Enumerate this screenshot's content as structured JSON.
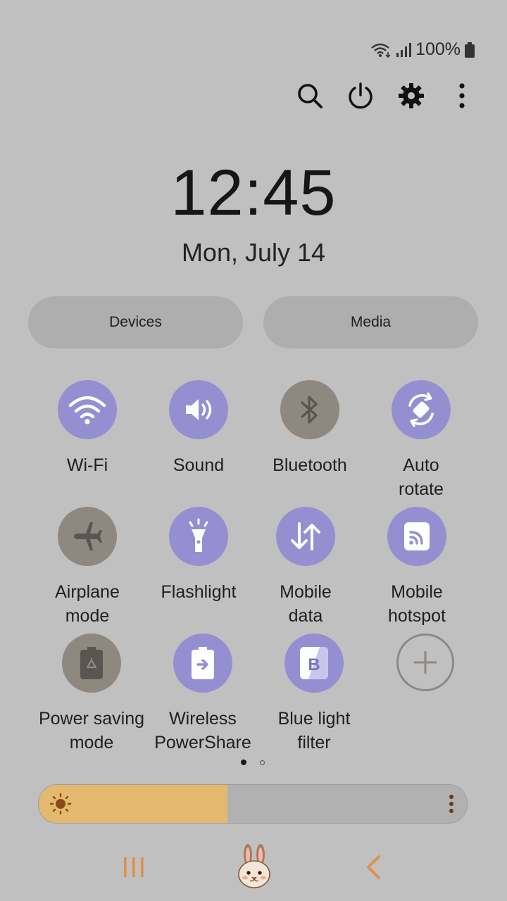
{
  "status_bar": {
    "battery_text": "100%",
    "icons": [
      "wifi-signal-icon",
      "cellular-signal-icon",
      "battery-icon"
    ]
  },
  "top_actions": [
    {
      "name": "search-icon"
    },
    {
      "name": "power-icon"
    },
    {
      "name": "settings-gear-icon"
    },
    {
      "name": "more-options-icon"
    }
  ],
  "clock": {
    "time": "12:45",
    "date": "Mon, July 14"
  },
  "pills": {
    "devices": "Devices",
    "media": "Media"
  },
  "tiles": [
    {
      "label": "Wi-Fi",
      "state": "on",
      "icon": "wifi-icon"
    },
    {
      "label": "Sound",
      "state": "on",
      "icon": "speaker-icon"
    },
    {
      "label": "Bluetooth",
      "state": "off",
      "icon": "bluetooth-icon"
    },
    {
      "label": "Auto\nrotate",
      "state": "on",
      "icon": "auto-rotate-icon"
    },
    {
      "label": "Airplane\nmode",
      "state": "off",
      "icon": "airplane-icon"
    },
    {
      "label": "Flashlight",
      "state": "on",
      "icon": "flashlight-icon"
    },
    {
      "label": "Mobile\ndata",
      "state": "on",
      "icon": "mobile-data-icon"
    },
    {
      "label": "Mobile\nhotspot",
      "state": "on",
      "icon": "hotspot-icon"
    },
    {
      "label": "Power saving\nmode",
      "state": "off",
      "icon": "battery-saver-icon"
    },
    {
      "label": "Wireless\nPowerShare",
      "state": "on",
      "icon": "powershare-icon"
    },
    {
      "label": "Blue light\nfilter",
      "state": "on",
      "icon": "blue-light-filter-icon"
    },
    {
      "label": "",
      "state": "add",
      "icon": "add-icon"
    }
  ],
  "page_indicator": {
    "pages": 2,
    "current": 1
  },
  "brightness": {
    "level": 0.44
  },
  "colors": {
    "accent_on": "#958fd2",
    "tile_off": "#8e8881",
    "brightness_fill": "#e2b96e",
    "nav_accent": "#e0904a"
  },
  "nav_bar": [
    "recent-apps-icon",
    "home-bunny-icon",
    "back-icon"
  ]
}
